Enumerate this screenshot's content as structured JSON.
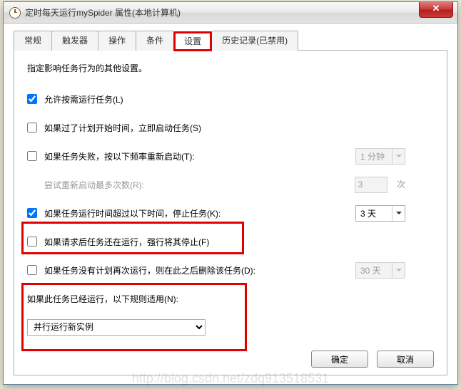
{
  "window": {
    "title": "定时每天运行mySpider 属性(本地计算机)",
    "close": "✕"
  },
  "tabs": {
    "t0": "常规",
    "t1": "触发器",
    "t2": "操作",
    "t3": "条件",
    "t4": "设置",
    "t5": "历史记录(已禁用)"
  },
  "panel": {
    "desc": "指定影响任务行为的其他设置。",
    "cb_allow_demand": "允许按需运行任务(L)",
    "cb_run_if_missed": "如果过了计划开始时间，立即启动任务(S)",
    "cb_restart_fail": "如果任务失败，按以下频率重新启动(T):",
    "restart_interval": "1 分钟",
    "retry_label": "尝试重新启动最多次数(R):",
    "retry_value": "3",
    "retry_suffix": "次",
    "cb_stop_longer": "如果任务运行时间超过以下时间，停止任务(K):",
    "stop_after": "3 天",
    "cb_force_stop": "如果请求后任务还在运行，强行将其停止(F)",
    "cb_delete_if_unscheduled": "如果任务没有计划再次运行，则在此之后删除该任务(D):",
    "delete_after": "30 天",
    "rule_label": "如果此任务已经运行，以下规则适用(N):",
    "rule_value": "并行运行新实例"
  },
  "buttons": {
    "ok": "确定",
    "cancel": "取消"
  },
  "watermark": "http://blog.csdn.net/zdq913518531"
}
